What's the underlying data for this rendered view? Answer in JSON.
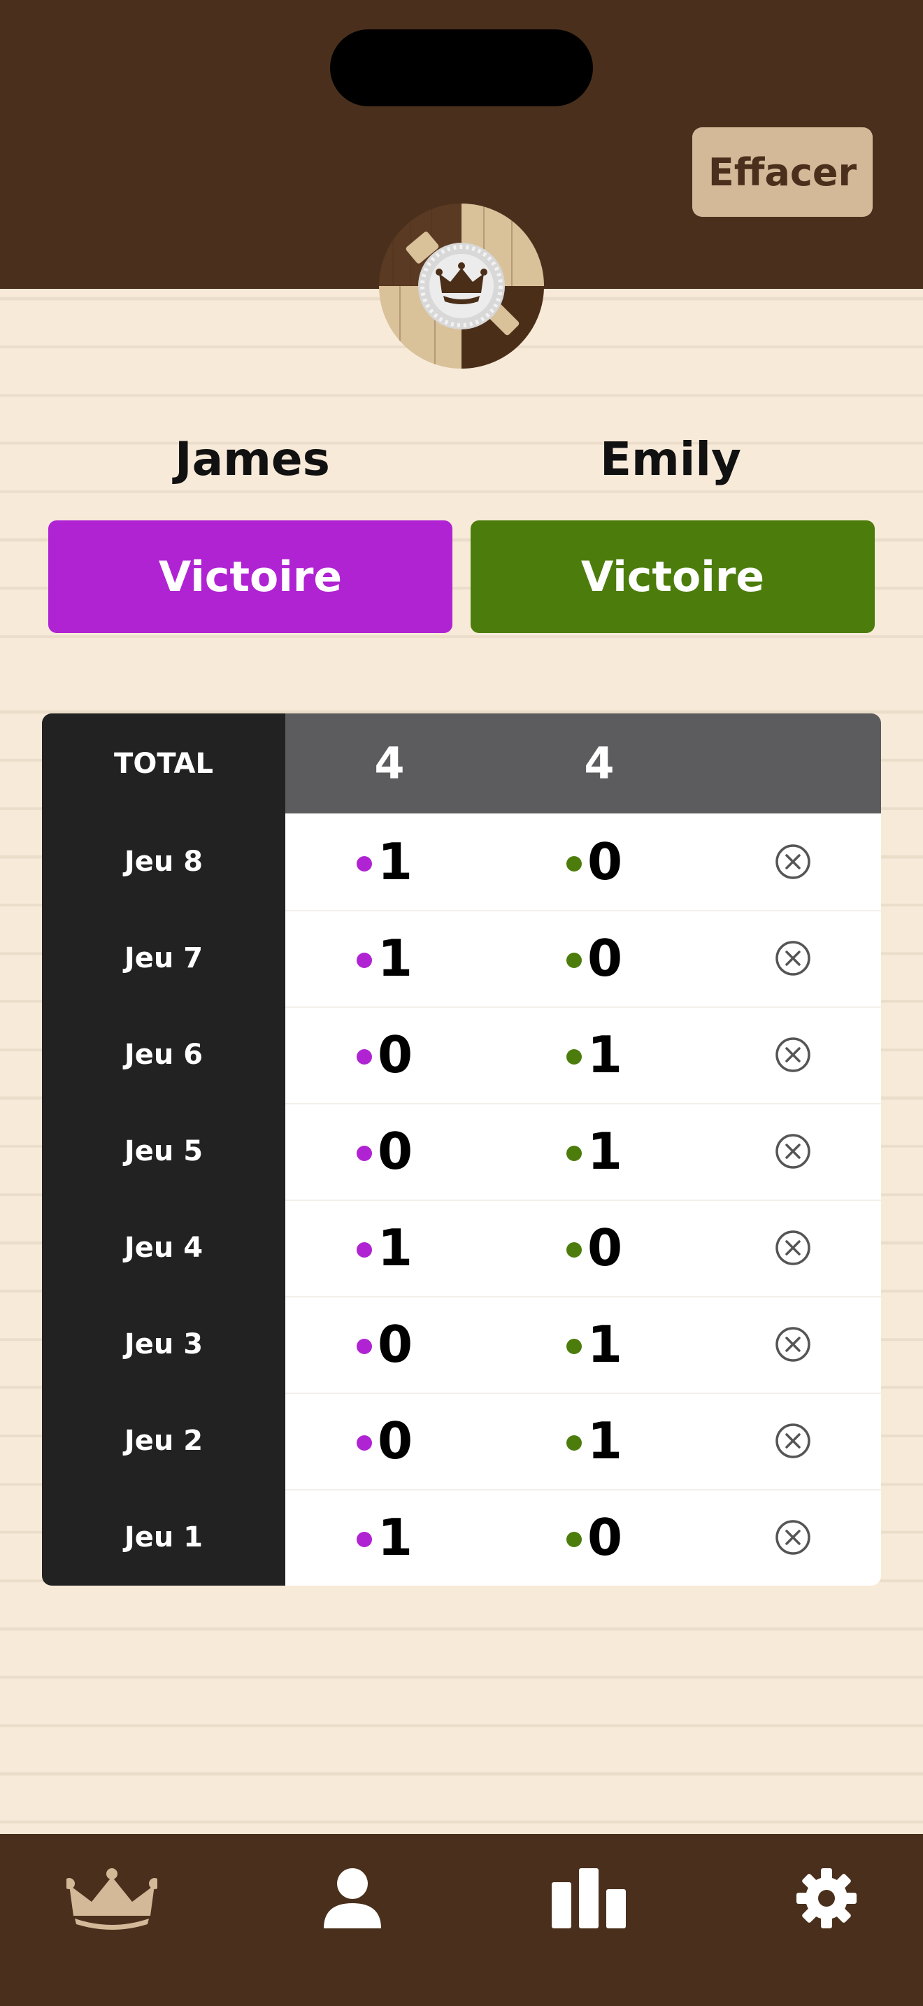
{
  "header": {
    "clear_label": "Effacer",
    "logo": "crown-badge-logo"
  },
  "players": [
    {
      "name": "James",
      "win_label": "Victoire",
      "color": "#b023d3"
    },
    {
      "name": "Emily",
      "win_label": "Victoire",
      "color": "#4c7d0c"
    }
  ],
  "scoreboard": {
    "total_label": "TOTAL",
    "totals": [
      "4",
      "4"
    ],
    "games": [
      {
        "label": "Jeu 8",
        "scores": [
          "1",
          "0"
        ]
      },
      {
        "label": "Jeu 7",
        "scores": [
          "1",
          "0"
        ]
      },
      {
        "label": "Jeu 6",
        "scores": [
          "0",
          "1"
        ]
      },
      {
        "label": "Jeu 5",
        "scores": [
          "0",
          "1"
        ]
      },
      {
        "label": "Jeu 4",
        "scores": [
          "1",
          "0"
        ]
      },
      {
        "label": "Jeu 3",
        "scores": [
          "0",
          "1"
        ]
      },
      {
        "label": "Jeu 2",
        "scores": [
          "0",
          "1"
        ]
      },
      {
        "label": "Jeu 1",
        "scores": [
          "1",
          "0"
        ]
      }
    ],
    "delete_icon": "circle-x-icon"
  },
  "tabbar": {
    "tabs": [
      {
        "icon": "crown-icon",
        "active": true
      },
      {
        "icon": "person-icon",
        "active": false
      },
      {
        "icon": "bar-chart-icon",
        "active": false
      },
      {
        "icon": "gear-icon",
        "active": false
      }
    ],
    "active_color": "#d3b998",
    "inactive_color": "#ffffff"
  }
}
